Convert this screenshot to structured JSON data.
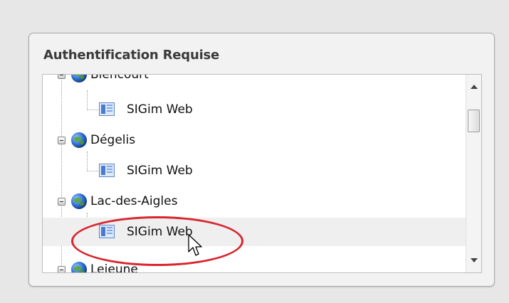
{
  "dialog": {
    "title": "Authentification Requise"
  },
  "tree": {
    "items": [
      {
        "label": "Biencourt",
        "type": "group"
      },
      {
        "label": "SIGim Web",
        "type": "app"
      },
      {
        "label": "Dégelis",
        "type": "group"
      },
      {
        "label": "SIGim Web",
        "type": "app"
      },
      {
        "label": "Lac-des-Aigles",
        "type": "group"
      },
      {
        "label": "SIGim Web",
        "type": "app",
        "selected": true
      },
      {
        "label": "Lejeune",
        "type": "group"
      }
    ]
  },
  "icons": {
    "group": "globe-icon",
    "app": "application-icon",
    "expander": "collapse-toggle-icon"
  },
  "colors": {
    "highlight": "#d8262e",
    "selected_row": "#efefef"
  }
}
